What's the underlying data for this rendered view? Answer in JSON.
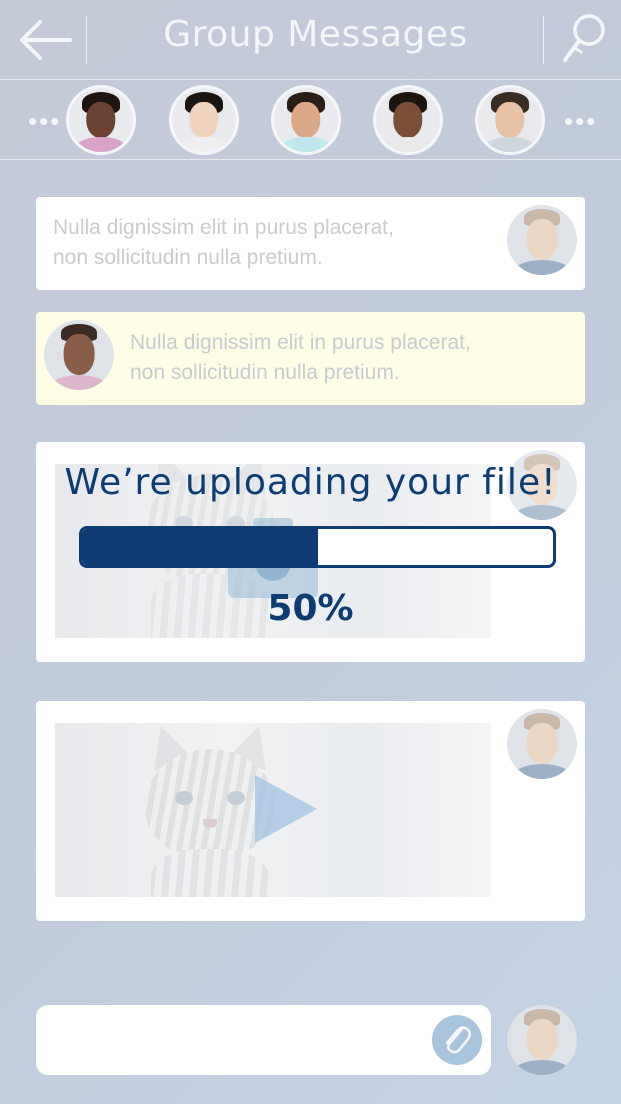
{
  "header": {
    "title": "Group Messages",
    "back_icon": "arrow-left-icon",
    "search_icon": "search-icon"
  },
  "participants": {
    "more_left": "•••",
    "more_right": "•••",
    "avatars": [
      {
        "name": "participant-1",
        "skin": "#6b4232",
        "hair": "#1e1410",
        "shirt": "#d9a2c8"
      },
      {
        "name": "participant-2",
        "skin": "#f1d4bd",
        "hair": "#1a1412",
        "shirt": "#efefef"
      },
      {
        "name": "participant-3",
        "skin": "#dba888",
        "hair": "#2a1d16",
        "shirt": "#bfe8ee"
      },
      {
        "name": "participant-4",
        "skin": "#7a4f37",
        "hair": "#1d140f",
        "shirt": "#e9e9e9"
      },
      {
        "name": "participant-5",
        "skin": "#e8c2a4",
        "hair": "#3a2c22",
        "shirt": "#cfd7de"
      }
    ]
  },
  "messages": [
    {
      "text_line1": "Nulla dignissim elit in purus placerat,",
      "text_line2": "non sollicitudin nulla pretium."
    },
    {
      "text_line1": "Nulla dignissim elit in purus placerat,",
      "text_line2": "non sollicitudin nulla pretium."
    }
  ],
  "upload": {
    "title": "We’re uploading your file!",
    "progress_fraction": 0.5,
    "percent_label": "50%"
  },
  "composer": {
    "value": "",
    "placeholder": "",
    "attach_icon": "paperclip-icon"
  },
  "colors": {
    "accent": "#0c3c72",
    "highlight_bg": "#fefde6",
    "overlay_blue": "#a8c4dc"
  }
}
